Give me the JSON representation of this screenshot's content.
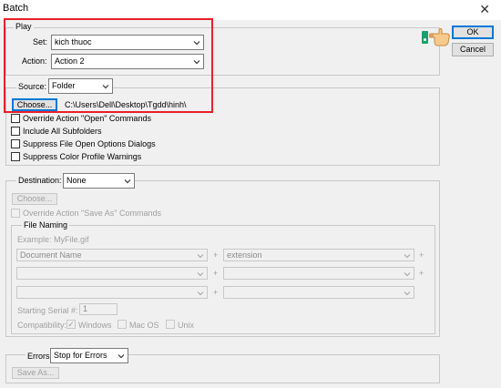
{
  "window": {
    "title": "Batch",
    "close": "✕"
  },
  "buttons": {
    "ok": "OK",
    "cancel": "Cancel"
  },
  "play": {
    "legend": "Play",
    "set_label": "Set:",
    "set_value": "kich thuoc",
    "action_label": "Action:",
    "action_value": "Action 2"
  },
  "source": {
    "label": "Source:",
    "value": "Folder",
    "choose": "Choose...",
    "path": "C:\\Users\\Dell\\Desktop\\Tgdd\\hinh\\",
    "options": [
      "Override Action \"Open\" Commands",
      "Include All Subfolders",
      "Suppress File Open Options Dialogs",
      "Suppress Color Profile Warnings"
    ]
  },
  "destination": {
    "label": "Destination:",
    "value": "None",
    "choose": "Choose...",
    "override": "Override Action \"Save As\" Commands",
    "file_naming": {
      "legend": "File Naming",
      "example": "Example: MyFile.gif",
      "row1_left": "Document Name",
      "row1_right": "extension",
      "plus": "+",
      "starting_serial_label": "Starting Serial #:",
      "starting_serial_value": "1",
      "compat_label": "Compatibility:",
      "windows": "Windows",
      "macos": "Mac OS",
      "unix": "Unix"
    }
  },
  "errors": {
    "label": "Errors:",
    "value": "Stop for Errors",
    "save_as": "Save As..."
  },
  "colors": {
    "highlight_border": "#e8202a",
    "focus_blue": "#0078d7"
  }
}
